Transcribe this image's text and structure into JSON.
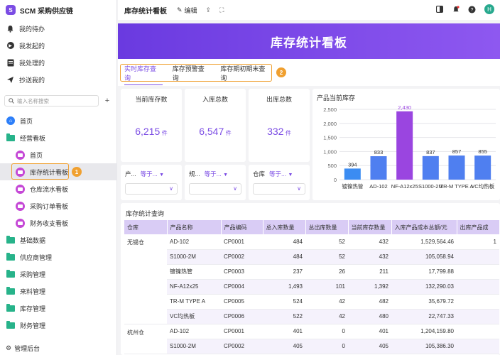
{
  "brand": {
    "logo": "S",
    "name": "SCM 采购供应链"
  },
  "quick": [
    {
      "label": "我的待办",
      "icon": "bell-icon"
    },
    {
      "label": "我发起的",
      "icon": "play-icon"
    },
    {
      "label": "我处理的",
      "icon": "doc-icon"
    },
    {
      "label": "抄送我的",
      "icon": "send-icon"
    }
  ],
  "search": {
    "placeholder": "输入名称搜索"
  },
  "nav": {
    "home": "首页",
    "group": "经营看板",
    "sub": [
      "首页",
      "库存统计看板",
      "仓库流水看板",
      "采购订单看板",
      "财务收支看板"
    ],
    "folders": [
      "基础数据",
      "供应商管理",
      "采购管理",
      "来料管理",
      "库存管理",
      "财务管理"
    ],
    "admin": "管理后台"
  },
  "topbar": {
    "title": "库存统计看板",
    "edit": "编辑",
    "avatar": "H"
  },
  "banner": {
    "title": "库存统计看板"
  },
  "tabs": [
    "实时库存查询",
    "库存预警查询",
    "库存期初期末查询"
  ],
  "badges": [
    "1",
    "2"
  ],
  "stats": [
    {
      "label": "当前库存数",
      "value": "6,215",
      "unit": "件"
    },
    {
      "label": "入库总数",
      "value": "6,547",
      "unit": "件"
    },
    {
      "label": "出库总数",
      "value": "332",
      "unit": "件"
    }
  ],
  "filters": [
    {
      "field": "产...",
      "op": "等于..."
    },
    {
      "field": "规...",
      "op": "等于..."
    },
    {
      "field": "仓库",
      "op": "等于..."
    }
  ],
  "chart_data": {
    "type": "bar",
    "title": "产品当前库存",
    "categories": [
      "镀镍热管",
      "AD-102",
      "NF-A12x25",
      "S1000-2M",
      "TR-M TYPE A",
      "VC均热板"
    ],
    "values": [
      394,
      833,
      2430,
      837,
      857,
      855
    ],
    "data_labels": [
      "394",
      "833",
      "2,430",
      "837",
      "857",
      "855"
    ],
    "yticks": [
      "0",
      "500",
      "1,000",
      "1,500",
      "2,000",
      "2,500"
    ],
    "ylim": [
      0,
      2500
    ],
    "grid": true,
    "colors": {
      "normal": "#4f7ff0",
      "highlight": "#9a45e0",
      "first": "#3b8cf2"
    }
  },
  "table": {
    "title": "库存统计查询",
    "columns": [
      "仓库",
      "产品名称",
      "产品编码",
      "总入库数量",
      "总出库数量",
      "当前库存数量",
      "入库产品成本总额/元",
      "出库产品成"
    ],
    "rows": [
      [
        "无锡仓",
        "AD-102",
        "CP0001",
        "484",
        "52",
        "432",
        "1,529,564.46",
        "1"
      ],
      [
        "",
        "S1000-2M",
        "CP0002",
        "484",
        "52",
        "432",
        "105,058.94",
        ""
      ],
      [
        "",
        "镀镍热管",
        "CP0003",
        "237",
        "26",
        "211",
        "17,799.88",
        ""
      ],
      [
        "",
        "NF-A12x25",
        "CP0004",
        "1,493",
        "101",
        "1,392",
        "132,290.03",
        ""
      ],
      [
        "",
        "TR-M TYPE A",
        "CP0005",
        "524",
        "42",
        "482",
        "35,679.72",
        ""
      ],
      [
        "",
        "VC均热板",
        "CP0006",
        "522",
        "42",
        "480",
        "22,747.33",
        ""
      ],
      [
        "杭州仓",
        "AD-102",
        "CP0001",
        "401",
        "0",
        "401",
        "1,204,159.80",
        ""
      ],
      [
        "",
        "S1000-2M",
        "CP0002",
        "405",
        "0",
        "405",
        "105,386.30",
        ""
      ]
    ]
  }
}
